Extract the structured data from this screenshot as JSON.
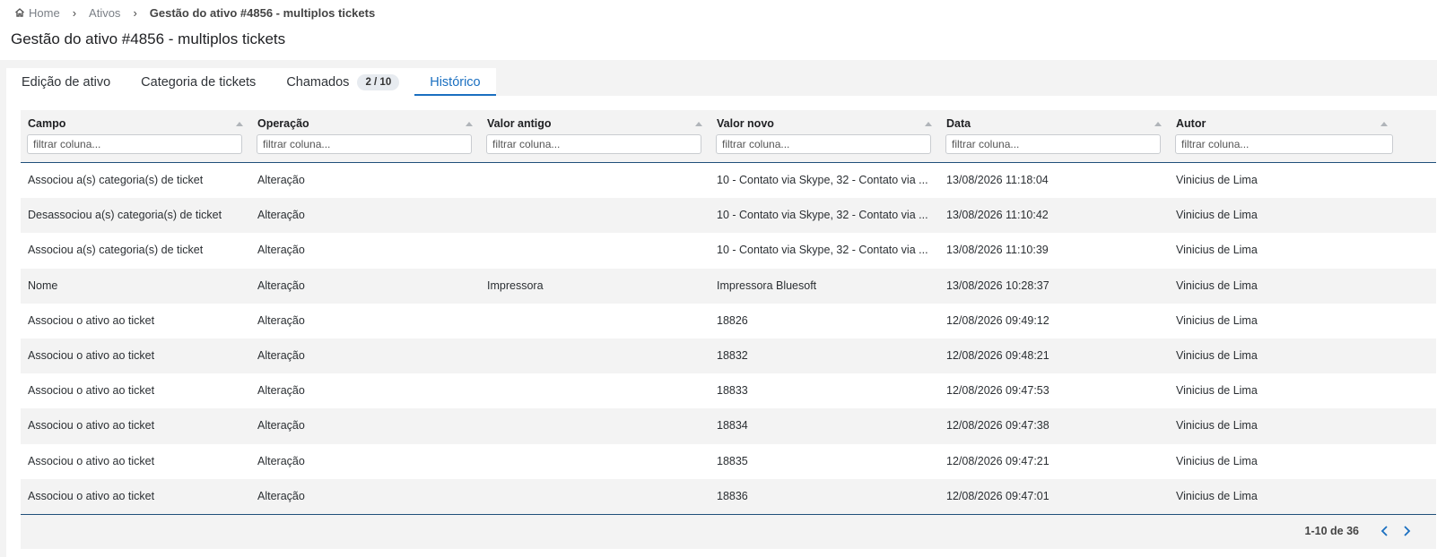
{
  "breadcrumb": {
    "home": "Home",
    "assets": "Ativos",
    "current": "Gestão do ativo #4856 - multiplos tickets"
  },
  "page": {
    "title": "Gestão do ativo #4856 - multiplos tickets"
  },
  "tabs": [
    {
      "label": "Edição de ativo"
    },
    {
      "label": "Categoria de tickets"
    },
    {
      "label": "Chamados",
      "badge": "2 / 10"
    },
    {
      "label": "Histórico",
      "active": true
    }
  ],
  "table": {
    "filter_placeholder": "filtrar coluna...",
    "columns": [
      "Campo",
      "Operação",
      "Valor antigo",
      "Valor novo",
      "Data",
      "Autor"
    ],
    "rows": [
      [
        "Associou a(s) categoria(s) de ticket",
        "Alteração",
        "",
        "10 - Contato via Skype, 32 - Contato via ...",
        "13/08/2026 11:18:04",
        "Vinicius de Lima"
      ],
      [
        "Desassociou a(s) categoria(s) de ticket",
        "Alteração",
        "",
        "10 - Contato via Skype, 32 - Contato via ...",
        "13/08/2026 11:10:42",
        "Vinicius de Lima"
      ],
      [
        "Associou a(s) categoria(s) de ticket",
        "Alteração",
        "",
        "10 - Contato via Skype, 32 - Contato via ...",
        "13/08/2026 11:10:39",
        "Vinicius de Lima"
      ],
      [
        "Nome",
        "Alteração",
        "Impressora",
        "Impressora Bluesoft",
        "13/08/2026 10:28:37",
        "Vinicius de Lima"
      ],
      [
        "Associou o ativo ao ticket",
        "Alteração",
        "",
        "18826",
        "12/08/2026 09:49:12",
        "Vinicius de Lima"
      ],
      [
        "Associou o ativo ao ticket",
        "Alteração",
        "",
        "18832",
        "12/08/2026 09:48:21",
        "Vinicius de Lima"
      ],
      [
        "Associou o ativo ao ticket",
        "Alteração",
        "",
        "18833",
        "12/08/2026 09:47:53",
        "Vinicius de Lima"
      ],
      [
        "Associou o ativo ao ticket",
        "Alteração",
        "",
        "18834",
        "12/08/2026 09:47:38",
        "Vinicius de Lima"
      ],
      [
        "Associou o ativo ao ticket",
        "Alteração",
        "",
        "18835",
        "12/08/2026 09:47:21",
        "Vinicius de Lima"
      ],
      [
        "Associou o ativo ao ticket",
        "Alteração",
        "",
        "18836",
        "12/08/2026 09:47:01",
        "Vinicius de Lima"
      ]
    ]
  },
  "pagination": {
    "range": "1-10 de 36"
  },
  "colors": {
    "accent": "#1a6fc0",
    "header_border": "#1f4f7a",
    "stripe": "#f3f3f3"
  },
  "icons": {
    "home": "home-icon",
    "sort": "sort-asc-icon",
    "prev": "chevron-left-icon",
    "next": "chevron-right-icon"
  }
}
